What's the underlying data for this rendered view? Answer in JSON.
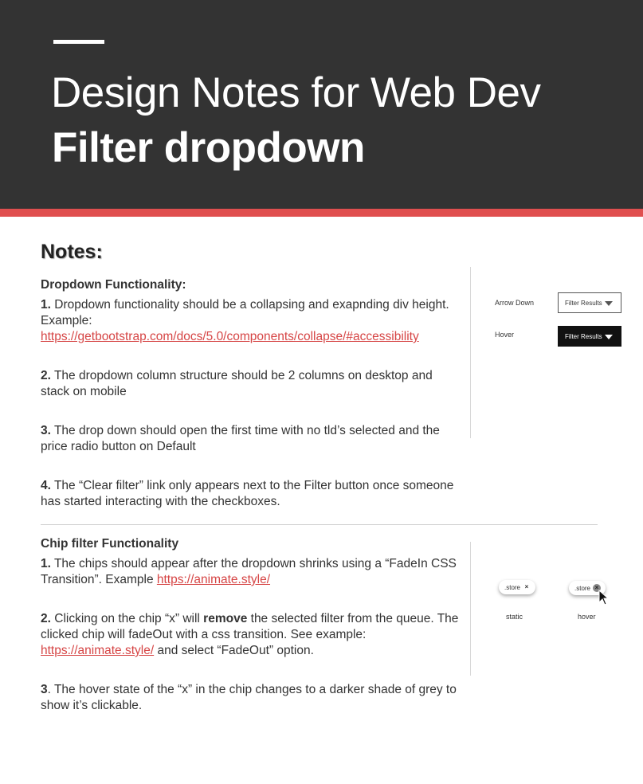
{
  "header": {
    "title_line1": "Design Notes for Web Dev",
    "title_line2": "Filter dropdown"
  },
  "notes_title": "Notes:",
  "dropdown": {
    "heading": "Dropdown Functionality:",
    "items": [
      {
        "num": "1.",
        "text": " Dropdown functionality should be a collapsing and exapnding div height. Example:",
        "link": "https://getbootstrap.com/docs/5.0/components/collapse/#accessibility"
      },
      {
        "num": "2.",
        "text": " The dropdown column structure should be 2 columns on desktop and stack on mobile"
      },
      {
        "num": "3.",
        "text": " The drop down should open the first time with no tld’s selected and the price radio button on Default"
      },
      {
        "num": "4.",
        "text": " The “Clear filter” link only appears next to the Filter button once someone has started interacting with the checkboxes."
      }
    ],
    "demo": {
      "arrow_down_label": "Arrow Down",
      "hover_label": "Hover",
      "button_text": "Filter Results"
    }
  },
  "chip": {
    "heading": "Chip filter Functionality",
    "item1": {
      "num": "1.",
      "text": " The chips should appear after the dropdown shrinks using a “FadeIn CSS Transition”. Example ",
      "link": "https://animate.style/"
    },
    "item2": {
      "num": "2.",
      "text_a": " Clicking on the chip “x” will ",
      "bold": "remove",
      "text_b": " the selected filter from the queue. The clicked chip will fadeOut with a css transition. See example: ",
      "link": "https://animate.style/",
      "text_c": " and select “FadeOut” option."
    },
    "item3": {
      "num": "3",
      "text": ". The hover state of the “x” in the chip changes to a darker shade of grey to show it’s clickable."
    },
    "demo": {
      "chip_text": ".store",
      "x_glyph": "×",
      "static_label": "static",
      "hover_label": "hover"
    }
  },
  "colors": {
    "header_bg": "#333333",
    "accent_red": "#e04f4f",
    "link": "#d64545"
  }
}
